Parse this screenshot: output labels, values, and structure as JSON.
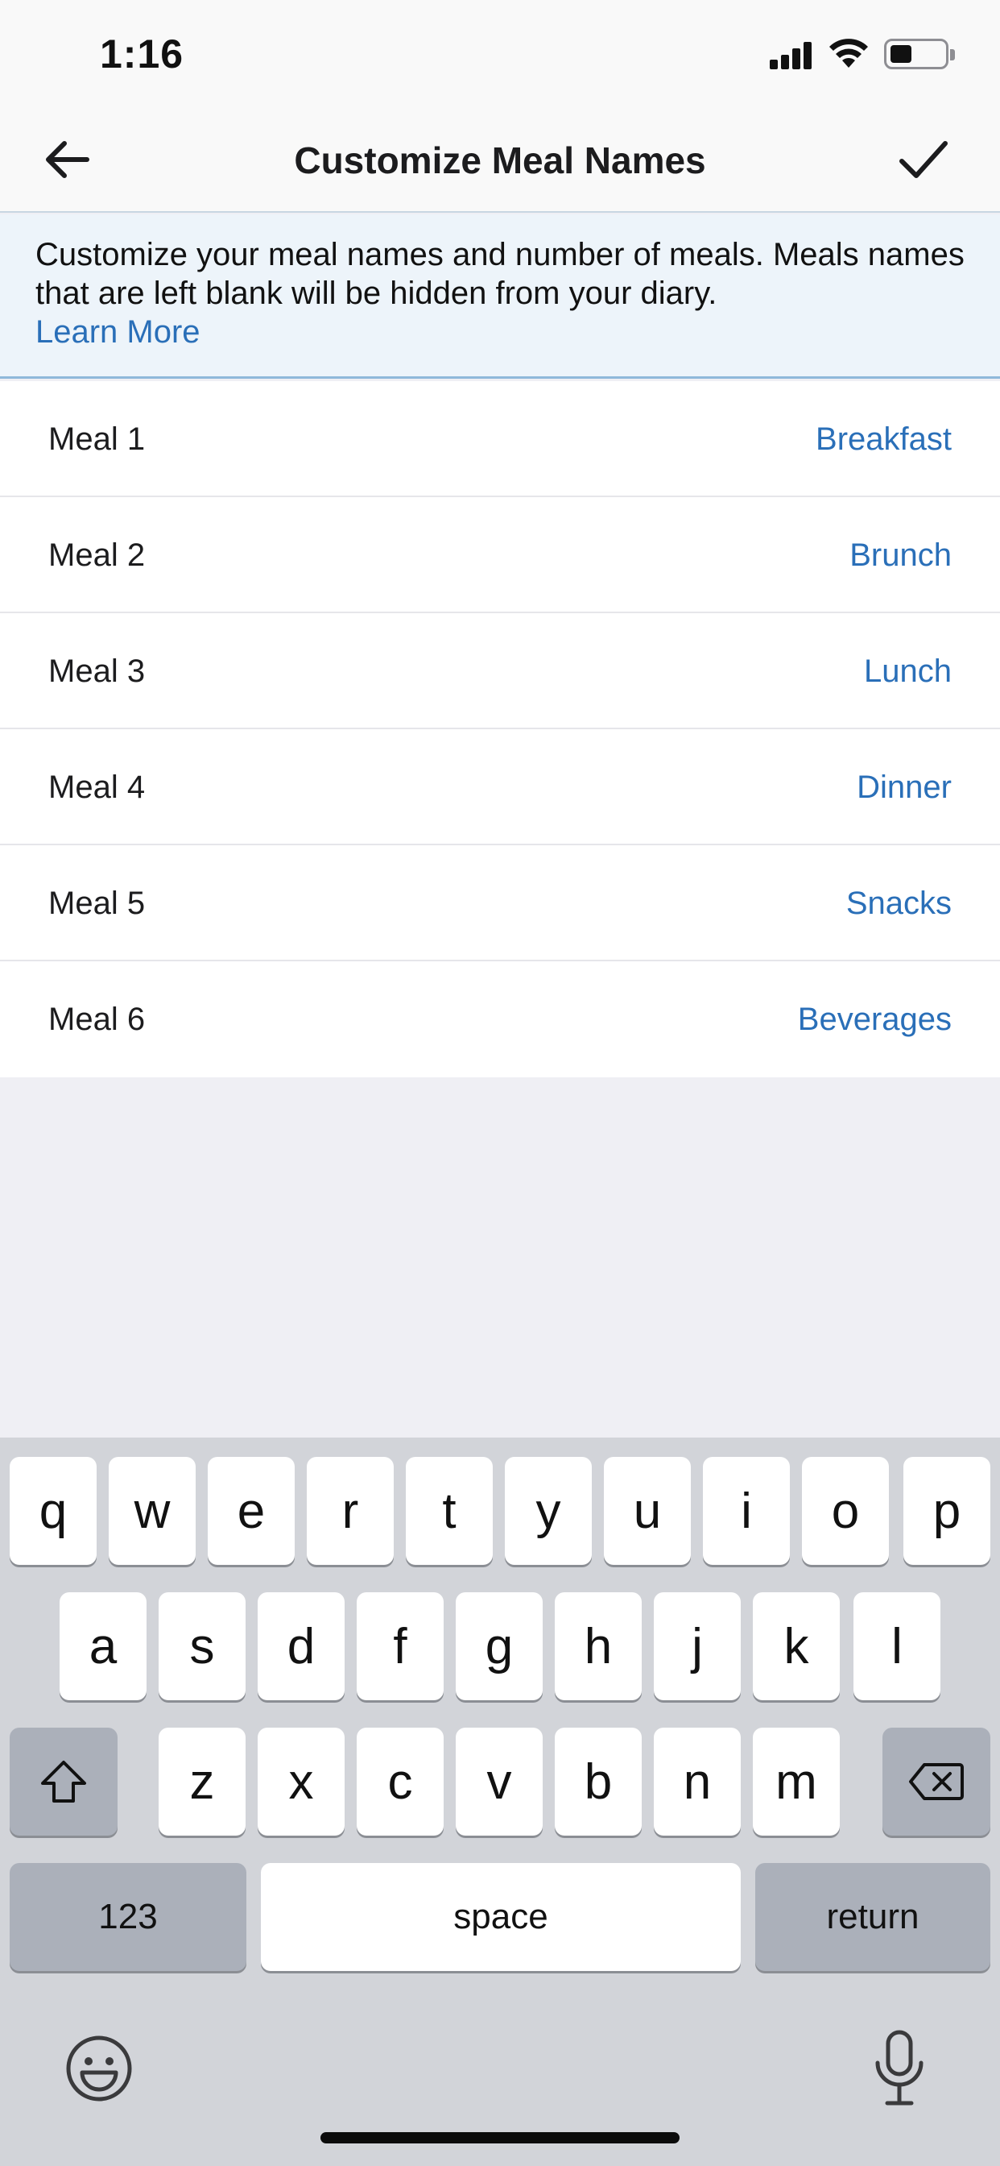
{
  "status_bar": {
    "time": "1:16"
  },
  "nav": {
    "title": "Customize Meal Names",
    "back_icon": "arrow-left-icon",
    "confirm_icon": "checkmark-icon"
  },
  "banner": {
    "text": "Customize your meal names and number of meals. Meals names that are left blank will be hidden from your diary.",
    "link": "Learn More"
  },
  "meals": [
    {
      "label": "Meal 1",
      "name": "Breakfast"
    },
    {
      "label": "Meal 2",
      "name": "Brunch"
    },
    {
      "label": "Meal 3",
      "name": "Lunch"
    },
    {
      "label": "Meal 4",
      "name": "Dinner"
    },
    {
      "label": "Meal 5",
      "name": "Snacks"
    },
    {
      "label": "Meal 6",
      "name": "Beverages"
    }
  ],
  "keyboard": {
    "row1": [
      "q",
      "w",
      "e",
      "r",
      "t",
      "y",
      "u",
      "i",
      "o",
      "p"
    ],
    "row2": [
      "a",
      "s",
      "d",
      "f",
      "g",
      "h",
      "j",
      "k",
      "l"
    ],
    "row3": [
      "z",
      "x",
      "c",
      "v",
      "b",
      "n",
      "m"
    ],
    "numbers_label": "123",
    "space_label": "space",
    "return_label": "return"
  },
  "colors": {
    "accent": "#2a6fb8",
    "banner_bg": "#edf4fa",
    "keyboard_bg": "#d2d4d9"
  }
}
